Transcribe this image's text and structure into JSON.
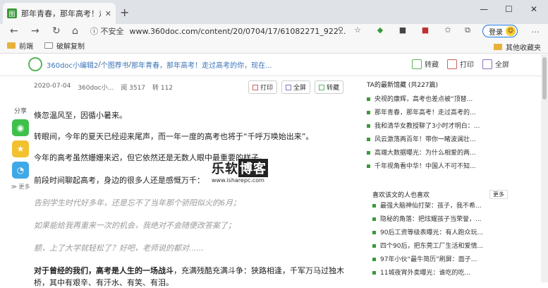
{
  "tab": {
    "favicon": "图",
    "title": "那年青春，那年高考！走过高考",
    "close": "✕"
  },
  "new_tab": "+",
  "window": {
    "minimize": "—",
    "maximize": "☐",
    "close": "✕"
  },
  "nav": {
    "back": "←",
    "forward": "→",
    "reload": "↻",
    "home": "⌂"
  },
  "address": {
    "security": "ⓘ 不安全",
    "url": "www.360doc.com/content/20/0704/17/61082271_922..."
  },
  "login": {
    "label": "登录"
  },
  "bookmarks": [
    {
      "label": "前端"
    },
    {
      "label": "破解复制"
    }
  ],
  "bookmarks_right": "其他收藏夹",
  "breadcrumb": {
    "site": "360doc小编辑2",
    "sep1": " / ",
    "book": "个图荐书",
    "sep2": " / ",
    "title": "那年青春，那年高考！走过高考的你，现在..."
  },
  "top_actions": {
    "favorite": "转藏",
    "print": "打印",
    "fullscreen": "全屏"
  },
  "meta": {
    "date": "2020-07-04",
    "author": "360doc小...",
    "reads": "阅 3517",
    "shares": "转 112"
  },
  "meta_actions": {
    "print": "打印",
    "fullscreen": "全屏",
    "favorite": "转藏"
  },
  "share": {
    "label": "分享",
    "more": "≫ 更多"
  },
  "article": {
    "p1": "倏忽温风至，因循小暑来。",
    "p2": "转眼间，今年的夏天已经迎来尾声，而一年一度的高考也将于“千呼万唤始出来”。",
    "p3": "今年的高考虽然姗姗来迟，但它依然还是无数人眼中最重要的样子。",
    "p4": "前段时间聊起高考，身边的很多人还是感慨万千：",
    "q1": "告别学生时代好多年，还是忘不了当年那个骄阳似火的6月；",
    "q2": "如果能给我再重来一次的机会，我绝对不会随便改答案了；",
    "q3": "额，上了大学就轻松了？好吧，老师说的都对......",
    "b1_strong": "对于曾经的我们，高考是人生的一场战斗",
    "b1_rest": "，充满残酷充满斗争：狭路相逢，千军万马过独木",
    "b2": "桥，其中有艰辛、有汗水、有笑、有泪。"
  },
  "watermark": {
    "line1a": "乐软",
    "line1b": "博客",
    "line2": "www.isharepc.com"
  },
  "sidebar": {
    "title": "TA的最新馆藏",
    "count": "(共227篇)",
    "items": [
      "央视的康辉，高考也差点被“顶替...",
      "那年青春，那年高考！走过高考的...",
      "我和清华女教授聊了3小时才明白：...",
      "风云激荡两百年！带你一睹波澜壮...",
      "高端大数据曝光：为什么相爱的两...",
      "千年视角看中华！中国人不可不知..."
    ]
  },
  "sidebar2": {
    "title": "喜欢该文的人也喜欢",
    "more": "更多",
    "items": [
      "最强大脑神仙打架：孩子，我不希...",
      "隐秘的角落：把炫耀孩子当荣誉，...",
      "90后工资等级表曝光：有人跑众玩...",
      "四个90后，把东莞工厂生活和爱情...",
      "97年小伙“最牛简历”刷屏：面子...",
      "11城夜宵外卖曝光：谁吃的吃..."
    ]
  }
}
